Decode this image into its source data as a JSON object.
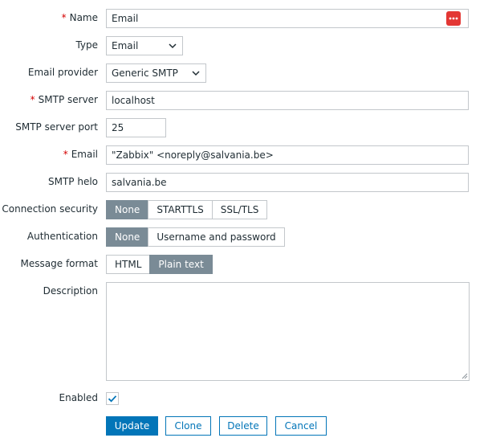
{
  "form": {
    "name": {
      "label": "Name",
      "value": "Email"
    },
    "type": {
      "label": "Type",
      "value": "Email"
    },
    "email_provider": {
      "label": "Email provider",
      "value": "Generic SMTP"
    },
    "smtp_server": {
      "label": "SMTP server",
      "value": "localhost"
    },
    "smtp_server_port": {
      "label": "SMTP server port",
      "value": "25"
    },
    "email": {
      "label": "Email",
      "value": "\"Zabbix\" <noreply@salvania.be>"
    },
    "smtp_helo": {
      "label": "SMTP helo",
      "value": "salvania.be"
    },
    "connection_security": {
      "label": "Connection security",
      "options": [
        "None",
        "STARTTLS",
        "SSL/TLS"
      ],
      "selected": "None"
    },
    "authentication": {
      "label": "Authentication",
      "options": [
        "None",
        "Username and password"
      ],
      "selected": "None"
    },
    "message_format": {
      "label": "Message format",
      "options": [
        "HTML",
        "Plain text"
      ],
      "selected": "Plain text"
    },
    "description": {
      "label": "Description",
      "value": ""
    },
    "enabled": {
      "label": "Enabled",
      "checked": true
    }
  },
  "actions": {
    "update": "Update",
    "clone": "Clone",
    "delete": "Delete",
    "cancel": "Cancel"
  },
  "colors": {
    "primary": "#0275b8",
    "segment_active": "#7a8b96",
    "required": "#d40000",
    "macro_icon": "#e33734"
  }
}
